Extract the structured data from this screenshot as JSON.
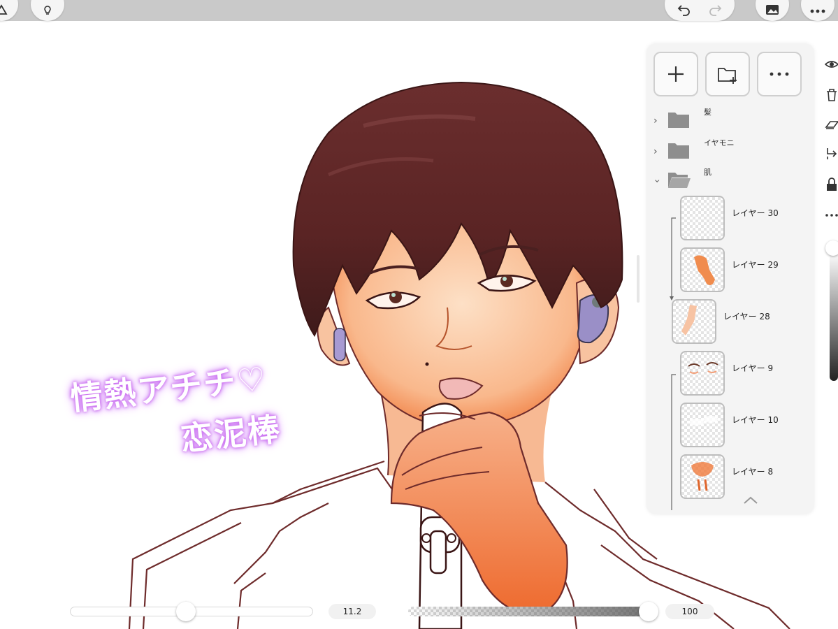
{
  "toolbar": {
    "left_icons": [
      "adjust-icon",
      "lightbulb-icon"
    ],
    "right_icons": [
      "undo-icon",
      "redo-icon",
      "gallery-icon",
      "more-icon"
    ]
  },
  "canvas": {
    "handwriting_line1": "情熱アチチ♡",
    "handwriting_line2": "恋泥棒"
  },
  "layers_panel": {
    "buttons": [
      "add-layer",
      "add-folder",
      "more-options"
    ],
    "folders": [
      {
        "name": "髪",
        "expanded": false
      },
      {
        "name": "イヤモニ",
        "expanded": false
      },
      {
        "name": "肌",
        "expanded": true
      }
    ],
    "layers": [
      {
        "name": "レイヤー 30"
      },
      {
        "name": "レイヤー 29"
      },
      {
        "name": "レイヤー 28"
      },
      {
        "name": "レイヤー 9"
      },
      {
        "name": "レイヤー 10"
      },
      {
        "name": "レイヤー 8"
      }
    ],
    "right_icons": [
      "eye-icon",
      "trash-icon",
      "clear-icon",
      "merge-icon",
      "lock-alpha-icon",
      "more-dots-icon"
    ],
    "opacity_level": 0.05
  },
  "bottom_bar": {
    "brush_size_value": "11.2",
    "brush_size_level": 0.5,
    "opacity_value": "100",
    "opacity_level": 1.0
  }
}
